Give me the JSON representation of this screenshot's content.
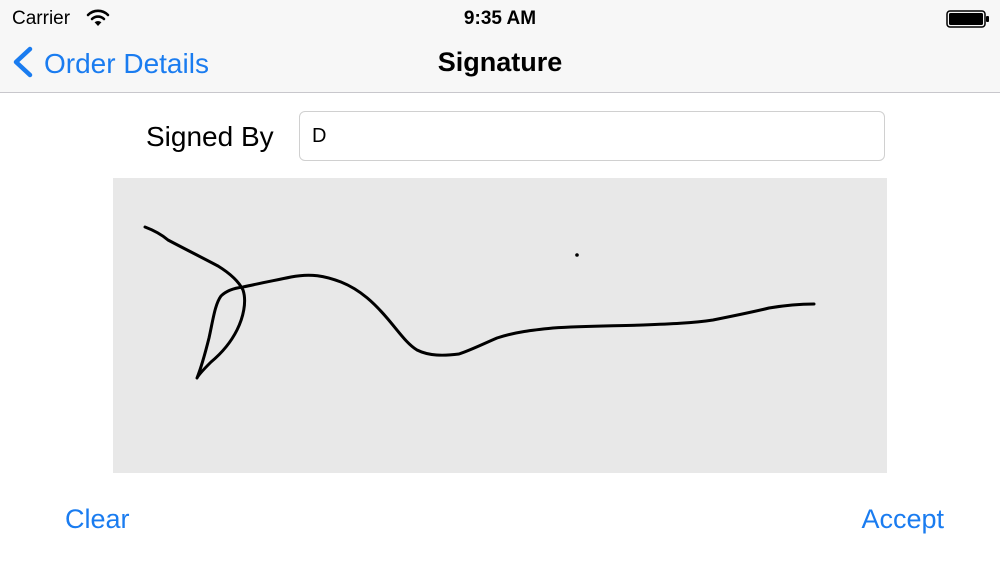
{
  "status_bar": {
    "carrier": "Carrier",
    "time": "9:35 AM",
    "icons": [
      "wifi-icon",
      "battery-icon"
    ]
  },
  "nav_bar": {
    "back_label": "Order Details",
    "back_icon": "chevron-left-icon",
    "title": "Signature"
  },
  "form": {
    "signed_by_label": "Signed By",
    "signed_by_value": "D"
  },
  "actions": {
    "clear_label": "Clear",
    "accept_label": "Accept"
  },
  "colors": {
    "accent": "#1a7cf0",
    "bar_background": "#f7f7f7",
    "pad_background": "#e8e8e8",
    "ink": "#000000"
  }
}
